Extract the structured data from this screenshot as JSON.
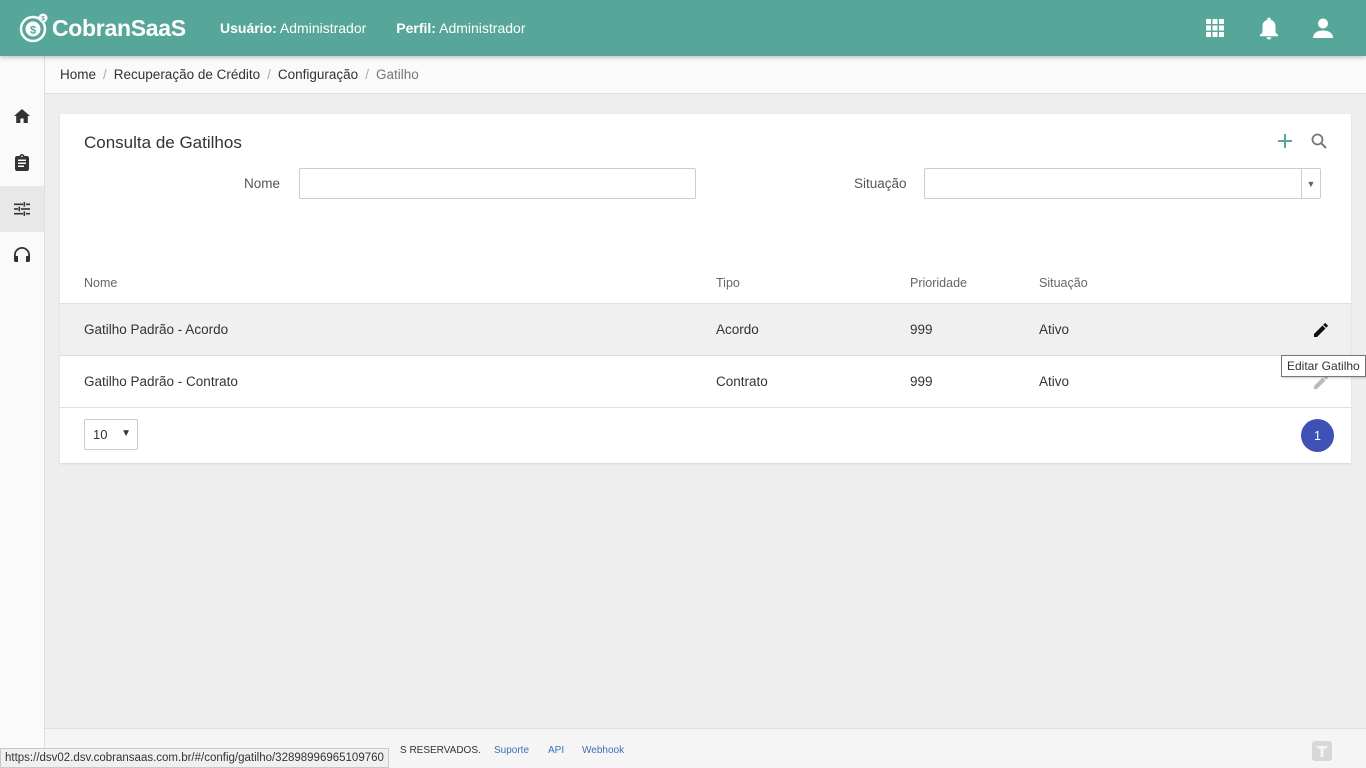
{
  "app": {
    "logo_text": "CobranSaaS"
  },
  "header": {
    "user_label": "Usuário:",
    "user_value": "Administrador",
    "profile_label": "Perfil:",
    "profile_value": "Administrador",
    "icons": [
      "apps-grid-icon",
      "bell-icon",
      "user-icon"
    ]
  },
  "sidebar": {
    "items": [
      "home-icon",
      "clipboard-icon",
      "tune-icon",
      "headset-icon"
    ],
    "active": "tune-icon"
  },
  "breadcrumb": [
    "Home",
    "Recuperação de Crédito",
    "Configuração",
    "Gatilho"
  ],
  "card": {
    "title": "Consulta de Gatilhos",
    "filters": {
      "nome_label": "Nome",
      "nome_value": "",
      "situacao_label": "Situação",
      "situacao_value": ""
    },
    "columns": [
      "Nome",
      "Tipo",
      "Prioridade",
      "Situação"
    ],
    "rows": [
      {
        "nome": "Gatilho Padrão - Acordo",
        "tipo": "Acordo",
        "prioridade": "999",
        "situacao": "Ativo"
      },
      {
        "nome": "Gatilho Padrão - Contrato",
        "tipo": "Contrato",
        "prioridade": "999",
        "situacao": "Ativo"
      }
    ],
    "page_size": "10",
    "current_page": "1"
  },
  "tooltip": "Editar Gatilho",
  "footer": {
    "rights": "S RESERVADOS.",
    "links": [
      "Suporte",
      "API",
      "Webhook"
    ]
  },
  "statusbar_url": "https://dsv02.dsv.cobransaas.com.br/#/config/gatilho/32898996965109760",
  "colors": {
    "header": "#56a799",
    "pagination": "#3f51b5",
    "link": "#3f6fb5"
  }
}
